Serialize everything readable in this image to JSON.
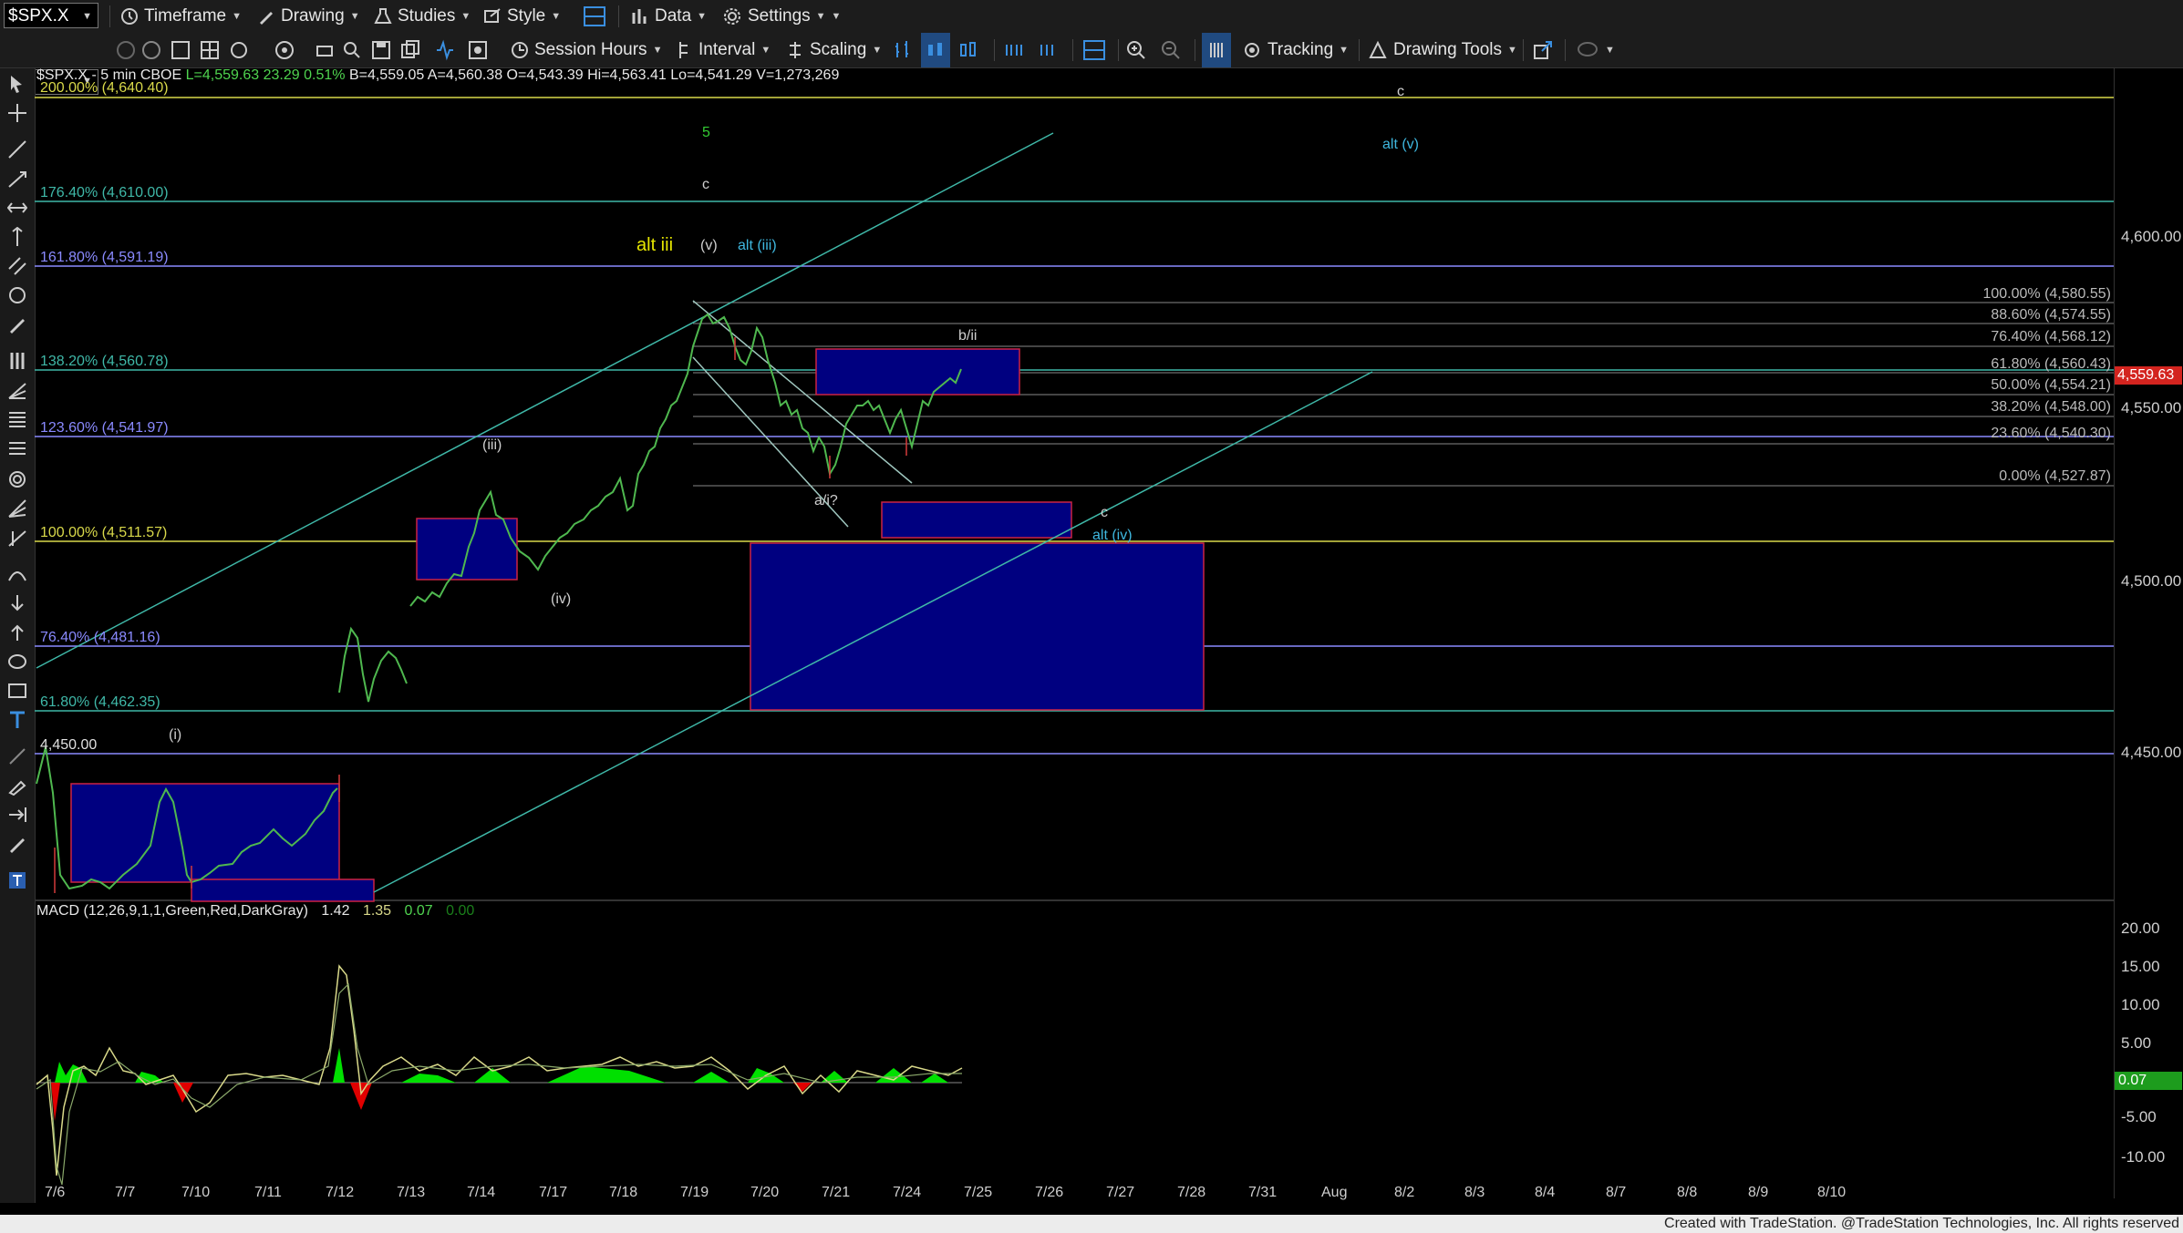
{
  "toolbar": {
    "symbol": "$SPX.X",
    "timeframe": "Timeframe",
    "drawing": "Drawing",
    "studies": "Studies",
    "style": "Style",
    "data": "Data",
    "settings": "Settings",
    "session_hours": "Session Hours",
    "interval": "Interval",
    "scaling": "Scaling",
    "tracking": "Tracking",
    "drawing_tools": "Drawing Tools"
  },
  "chart_info": {
    "symbol": "$SPX.X - 5 min",
    "exchange": "CBOE",
    "last": "L=4,559.63",
    "change": "23.29",
    "change_pct": "0.51%",
    "bid": "B=4,559.05",
    "ask": "A=4,560.38",
    "open": "O=4,543.39",
    "high": "Hi=4,563.41",
    "low": "Lo=4,541.29",
    "volume": "V=1,273,269"
  },
  "macd_info": {
    "label": "MACD (12,26,9,1,1,Green,Red,DarkGray)",
    "v1": "1.42",
    "v2": "1.35",
    "v3": "0.07",
    "v4": "0.00"
  },
  "price_badge": "4,559.63",
  "macd_badge": "0.07",
  "price_axis": [
    "4,600.00",
    "4,550.00",
    "4,500.00",
    "4,450.00"
  ],
  "macd_axis": [
    "20.00",
    "15.00",
    "10.00",
    "5.00",
    "-5.00",
    "-10.00"
  ],
  "date_axis": [
    "7/6",
    "7/7",
    "7/10",
    "7/11",
    "7/12",
    "7/13",
    "7/14",
    "7/17",
    "7/18",
    "7/19",
    "7/20",
    "7/21",
    "7/24",
    "7/25",
    "7/26",
    "7/27",
    "7/28",
    "7/31",
    "Aug",
    "8/2",
    "8/3",
    "8/4",
    "8/7",
    "8/8",
    "8/9",
    "8/10"
  ],
  "fib_left": [
    {
      "label": "200.00% (4,640.40)",
      "color": "#d9d94a"
    },
    {
      "label": "176.40% (4,610.00)",
      "color": "#3fb8a8"
    },
    {
      "label": "161.80% (4,591.19)",
      "color": "#8a8aff"
    },
    {
      "label": "138.20% (4,560.78)",
      "color": "#3fb8a8"
    },
    {
      "label": "123.60% (4,541.97)",
      "color": "#8a8aff"
    },
    {
      "label": "100.00% (4,511.57)",
      "color": "#d9d94a"
    },
    {
      "label": "76.40% (4,481.16)",
      "color": "#8a8aff"
    },
    {
      "label": "61.80% (4,462.35)",
      "color": "#3fb8a8"
    },
    {
      "label": "4,450.00",
      "color": "#e0e0e0"
    }
  ],
  "fib_right": [
    "100.00% (4,580.55)",
    "88.60% (4,574.55)",
    "76.40% (4,568.12)",
    "61.80% (4,560.43)",
    "50.00% (4,554.21)",
    "38.20% (4,548.00)",
    "23.60% (4,540.30)",
    "0.00% (4,527.87)"
  ],
  "wave_labels": {
    "c_top": "c",
    "alt_v": "alt (v)",
    "five": "5",
    "c_mid": "c",
    "alt_iii": "alt iii",
    "v": "(v)",
    "alt_iii_paren": "alt (iii)",
    "bii": "b/ii",
    "iii": "(iii)",
    "aii": "a/i?",
    "c_low": "c",
    "alt_iv": "alt (iv)",
    "iv": "(iv)",
    "i": "(i)"
  },
  "footer": "Created with TradeStation. @TradeStation Technologies, Inc. All rights reserved",
  "colors": {
    "fib_yellow": "#d9d94a",
    "fib_teal": "#3fb8a8",
    "fib_blue": "#8a8aff",
    "box_fill": "#000080",
    "box_border": "#cc2244",
    "macd_green": "#00e000",
    "macd_red": "#e00000"
  }
}
